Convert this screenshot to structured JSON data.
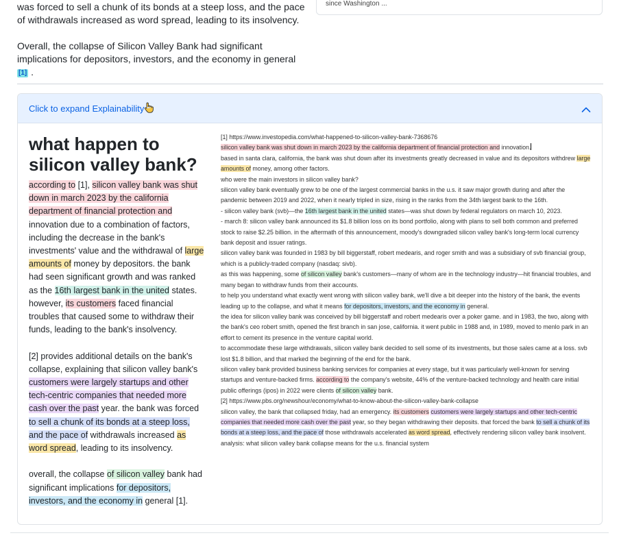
{
  "top_text": {
    "para1": "was forced to sell a chunk of its bonds at a steep loss, and the pace of withdrawals increased as word spread, leading to its insolvency.",
    "para2_prefix": "Overall, the collapse of Silicon Valley Bank had significant implications for depositors, investors, and the economy in general",
    "para2_cite": "[1]",
    "para2_suffix": "."
  },
  "top_right_card": {
    "snippet": "since Washington ..."
  },
  "accordion": {
    "header_label": "Click to expand Explainability",
    "hand_icon": "pointing-hand-icon",
    "chevron_icon": "chevron-up-icon",
    "accent_color": "#0c63e4",
    "header_bg": "#e7f1ff"
  },
  "explain": {
    "question": "what happen to silicon valley bank?",
    "answer": {
      "p1": [
        {
          "t": "according to",
          "c": "hl-red"
        },
        {
          "t": " [1], ",
          "c": ""
        },
        {
          "t": "silicon valley bank was shut down in march 2023 by the california department of financial protection and",
          "c": "hl-red"
        },
        {
          "t": " innovation due to a combination of factors, including the decrease in the bank's investments' value and the withdrawal of ",
          "c": ""
        },
        {
          "t": "large amounts of",
          "c": "hl-yellow"
        },
        {
          "t": " money by depositors. the bank had seen significant growth and was ranked as the ",
          "c": ""
        },
        {
          "t": "16th largest bank in the united",
          "c": "hl-teal"
        },
        {
          "t": " states. however, ",
          "c": ""
        },
        {
          "t": "its customers",
          "c": "hl-red"
        },
        {
          "t": " faced financial troubles that caused some to withdraw their funds, leading to the bank's insolvency.",
          "c": ""
        }
      ],
      "p2": [
        {
          "t": "[2] provides additional details on the bank's collapse, explaining that silicon valley bank's ",
          "c": ""
        },
        {
          "t": "customers were largely startups and other tech-centric companies that needed more cash over the past",
          "c": "hl-purple"
        },
        {
          "t": " year. the bank was forced ",
          "c": ""
        },
        {
          "t": "to sell a chunk of its bonds at a steep loss, and the pace of",
          "c": "hl-blue"
        },
        {
          "t": " withdrawals increased ",
          "c": ""
        },
        {
          "t": "as word spread",
          "c": "hl-yellow"
        },
        {
          "t": ", leading to its insolvency.",
          "c": ""
        }
      ],
      "p3": [
        {
          "t": "overall, the collapse ",
          "c": ""
        },
        {
          "t": "of silicon valley",
          "c": "hl-green"
        },
        {
          "t": " bank had significant implications ",
          "c": ""
        },
        {
          "t": "for depositors, investors, and the economy in",
          "c": "hl-cyan"
        },
        {
          "t": " general [1].",
          "c": ""
        }
      ]
    },
    "sources": [
      [
        {
          "t": "[1] https://www.investopedia.com/what-happened-to-silicon-valley-bank-7368676",
          "c": ""
        }
      ],
      [
        {
          "t": "silicon valley bank was shut down in march 2023 by the california department of financial protection and",
          "c": "hl-red"
        },
        {
          "t": " innovation.",
          "c": ""
        }
      ],
      [
        {
          "t": "based in santa clara, california, the bank was shut down after its investments greatly decreased in value and its depositors withdrew ",
          "c": ""
        },
        {
          "t": "large amounts of",
          "c": "hl-yellow"
        },
        {
          "t": " money, among other factors.",
          "c": ""
        }
      ],
      [
        {
          "t": "who were the main investors in silicon valley bank?",
          "c": ""
        }
      ],
      [
        {
          "t": "silicon valley bank eventually grew to be one of the largest commercial banks in the u.s. it saw major growth during and after the pandemic between 2019 and 2022, when it nearly tripled in size, rising in the ranks from the 34th largest bank to the 16th.",
          "c": ""
        }
      ],
      [
        {
          "t": "- silicon valley bank (svb)—the ",
          "c": ""
        },
        {
          "t": "16th largest bank in the united",
          "c": "hl-teal"
        },
        {
          "t": " states—was shut down by federal regulators on march 10, 2023.",
          "c": ""
        }
      ],
      [
        {
          "t": "- march 8: silicon valley bank announced its $1.8 billion loss on its bond portfolio, along with plans to sell both common and preferred stock to raise $2.25 billion. in the aftermath of this announcement, moody's downgraded silicon valley bank's long-term local currency bank deposit and issuer ratings.",
          "c": ""
        }
      ],
      [
        {
          "t": "silicon valley bank was founded in 1983 by bill biggerstaff, robert medearis, and roger smith and was a subsidiary of svb financial group, which is a publicly-traded company (nasdaq: sivb).",
          "c": ""
        }
      ],
      [
        {
          "t": "as this was happening, some ",
          "c": ""
        },
        {
          "t": "of silicon valley",
          "c": "hl-green"
        },
        {
          "t": " bank's customers—many of whom are in the technology industry—hit financial troubles, and many began to withdraw funds from their accounts.",
          "c": ""
        }
      ],
      [
        {
          "t": "to help you understand what exactly went wrong with silicon valley bank, we'll dive a bit deeper into the history of the bank, the events leading up to the collapse, and what it means ",
          "c": ""
        },
        {
          "t": "for depositors, investors, and the economy in",
          "c": "hl-cyan"
        },
        {
          "t": " general.",
          "c": ""
        }
      ],
      [
        {
          "t": "the idea for silicon valley bank was conceived by bill biggerstaff and robert medearis over a poker game. and in 1983, the two, along with the bank's ceo robert smith, opened the first branch in san jose, california. it went public in 1988 and, in 1989, moved to menlo park in an effort to cement its presence in the venture capital world.",
          "c": ""
        }
      ],
      [
        {
          "t": "to accommodate these large withdrawals, silicon valley bank decided to sell some of its investments, but those sales came at a loss. svb lost $1.8 billion, and that marked the beginning of the end for the bank.",
          "c": ""
        }
      ],
      [
        {
          "t": "silicon valley bank provided business banking services for companies at every stage, but it was particularly well-known for serving startups and venture-backed firms. ",
          "c": ""
        },
        {
          "t": "according to",
          "c": "hl-red"
        },
        {
          "t": " the company's website, 44% of the venture-backed technology and health care initial public offerings (ipos) in 2022 were clients ",
          "c": ""
        },
        {
          "t": "of silicon valley",
          "c": "hl-green"
        },
        {
          "t": " bank.",
          "c": ""
        }
      ],
      [
        {
          "t": "[2] https://www.pbs.org/newshour/economy/what-to-know-about-the-silicon-valley-bank-collapse",
          "c": ""
        }
      ],
      [
        {
          "t": "silicon valley, the bank that collapsed friday, had an emergency. ",
          "c": ""
        },
        {
          "t": "its customers",
          "c": "hl-red"
        },
        {
          "t": " ",
          "c": ""
        },
        {
          "t": "customers were largely startups and other tech-centric companies that needed more cash over the past",
          "c": "hl-purple"
        },
        {
          "t": " year, so they began withdrawing their deposits. that forced the bank ",
          "c": ""
        },
        {
          "t": "to sell a chunk of its bonds at a steep loss, and the pace of",
          "c": "hl-blue"
        },
        {
          "t": " those withdrawals accelerated ",
          "c": ""
        },
        {
          "t": "as word spread",
          "c": "hl-yellow"
        },
        {
          "t": ", effectively rendering silicon valley bank insolvent.",
          "c": ""
        }
      ],
      [
        {
          "t": "analysis: what silicon valley bank collapse means for the u.s. financial system",
          "c": ""
        }
      ]
    ]
  }
}
